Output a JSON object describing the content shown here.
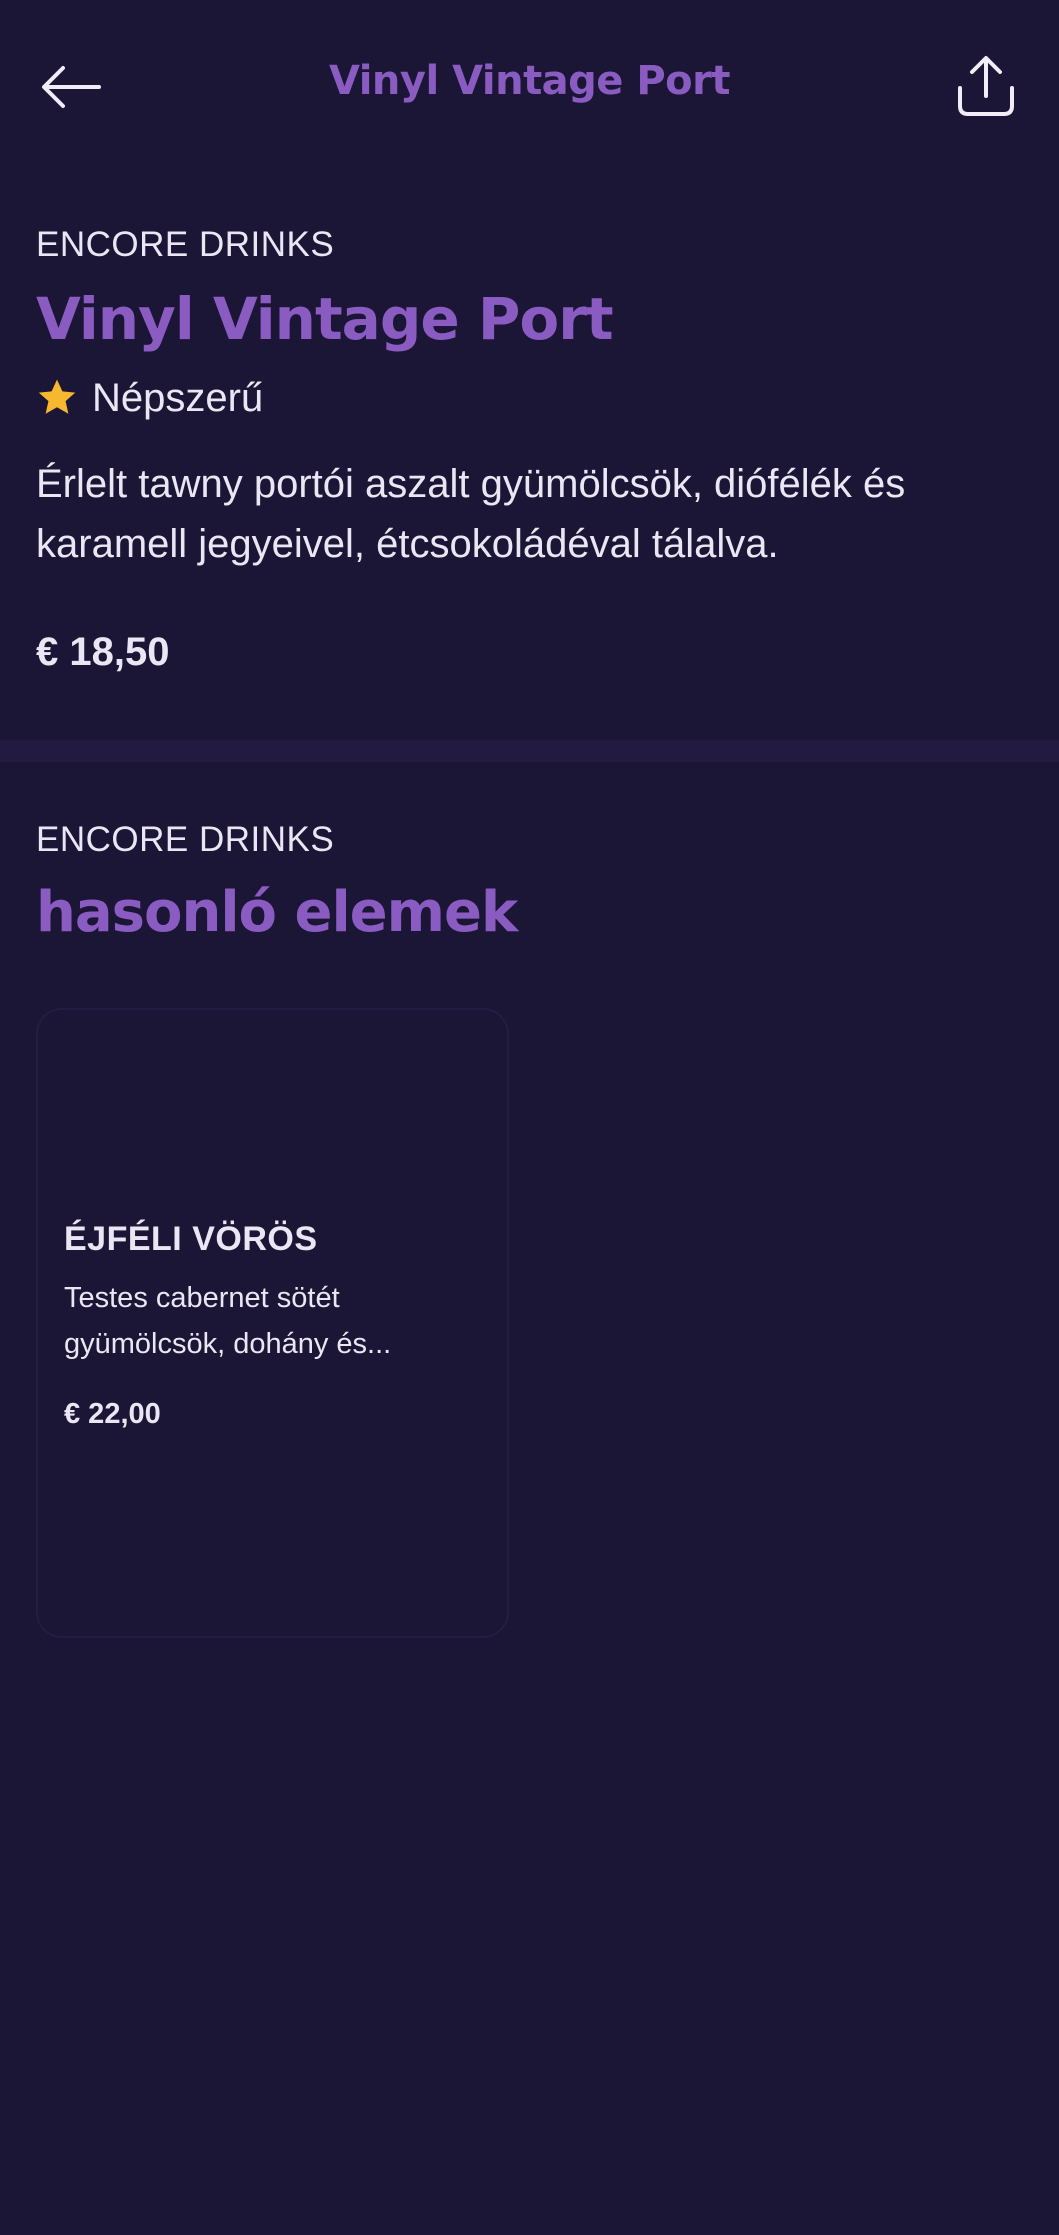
{
  "header": {
    "title": "Vinyl Vintage Port",
    "back_icon": "arrow-left-icon",
    "share_icon": "share-icon"
  },
  "product": {
    "brand": "ENCORE DRINKS",
    "name": "Vinyl Vintage Port",
    "badge_icon": "star-icon",
    "badge_label": "Népszerű",
    "description": "Érlelt tawny portói aszalt gyümölcsök, diófélék és karamell jegyeivel, étcsokoládéval tálalva.",
    "price": "€ 18,50"
  },
  "similar": {
    "brand": "ENCORE DRINKS",
    "title": "hasonló elemek",
    "items": [
      {
        "name": "ÉJFÉLI VÖRÖS",
        "description": "Testes cabernet sötét gyümölcsök, dohány és...",
        "price": "€ 22,00"
      }
    ]
  },
  "colors": {
    "background": "#1c1636",
    "accent": "#8a5cc2",
    "text": "#ebe6f3",
    "star": "#f5b82e"
  }
}
